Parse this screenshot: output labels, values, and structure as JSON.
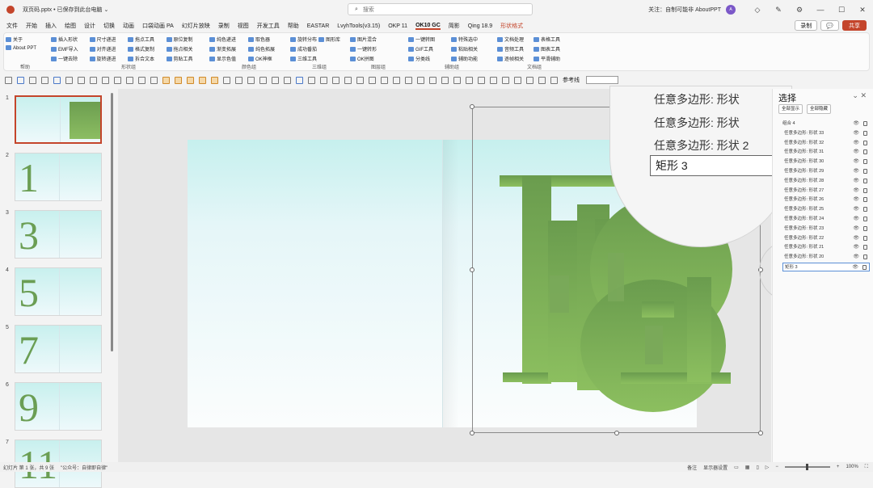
{
  "title_bar": {
    "file_name": "双页码.pptx • 已保存到此台电脑 ⌄",
    "search_placeholder": "搜索",
    "follow_text": "关注：自制可能非 AboutPPT",
    "avatar_text": "A",
    "icons": [
      "diamond-icon",
      "pen-icon",
      "settings-icon",
      "minimize-icon",
      "maximize-icon",
      "close-icon"
    ]
  },
  "menu": {
    "items": [
      "文件",
      "开始",
      "插入",
      "绘图",
      "设计",
      "切换",
      "动画",
      "口袋动画 PA",
      "幻灯片放映",
      "录制",
      "视图",
      "开发工具",
      "帮助",
      "EASTAR",
      "LvyhTools(v3.15)",
      "OKP 11",
      "OK10 GC",
      "简影",
      "Qing 18.9",
      "形状格式"
    ],
    "active_index": 16,
    "accent_index": 19,
    "record_label": "录制",
    "share_label": "共享"
  },
  "ribbon": {
    "groups": [
      {
        "label": "帮助",
        "buttons": [
          "关于",
          "About PPT"
        ]
      },
      {
        "label": "形状组",
        "buttons": [
          "插入形状",
          "EMF导入",
          "一键去除",
          "尺寸递进",
          "对齐递进",
          "旋转递进",
          "拖点工具",
          "格式复制",
          "拆合文本",
          "原位复制",
          "拖点相关",
          "剪贴工具"
        ]
      },
      {
        "label": "颜色组",
        "buttons": [
          "纯色递进",
          "渐变拓展",
          "显示色值",
          "取色器",
          "纯色拓展",
          "OK神框"
        ]
      },
      {
        "label": "三维组",
        "buttons": [
          "旋转分布",
          "成功番茄",
          "三维工具",
          "图形库"
        ]
      },
      {
        "label": "图层组",
        "buttons": [
          "图片混合",
          "一键转形",
          "OK拼图"
        ]
      },
      {
        "label": "辅助组",
        "buttons": [
          "一键转图",
          "GIF工具",
          "分类线",
          "特殊选中",
          "粘贴相关",
          "辅助功能"
        ]
      },
      {
        "label": "文档组",
        "buttons": [
          "文档处理",
          "音频工具",
          "逐帧相关",
          "表格工具",
          "图表工具",
          "平滑辅助"
        ]
      }
    ]
  },
  "toolbar": {
    "reference_line_label": "参考线"
  },
  "thumbnails": [
    {
      "number": "1",
      "digit": "",
      "has_green": true,
      "selected": true
    },
    {
      "number": "2",
      "digit": "1",
      "has_green": false,
      "selected": false
    },
    {
      "number": "3",
      "digit": "3",
      "has_green": false,
      "selected": false
    },
    {
      "number": "4",
      "digit": "5",
      "has_green": false,
      "selected": false
    },
    {
      "number": "5",
      "digit": "7",
      "has_green": false,
      "selected": false
    },
    {
      "number": "6",
      "digit": "9",
      "has_green": false,
      "selected": false
    },
    {
      "number": "7",
      "digit": "11",
      "has_green": false,
      "selected": false
    }
  ],
  "magnifier": {
    "items": [
      "任意多边形: 形状",
      "任意多边形: 形状",
      "任意多边形: 形状 2"
    ],
    "input_value": "矩形 3"
  },
  "selection_pane": {
    "title": "选择",
    "show_all": "全部显示",
    "hide_all": "全部隐藏",
    "layers": [
      "组合 4",
      "任意多边形: 形状 33",
      "任意多边形: 形状 32",
      "任意多边形: 形状 31",
      "任意多边形: 形状 30",
      "任意多边形: 形状 29",
      "任意多边形: 形状 28",
      "任意多边形: 形状 27",
      "任意多边形: 形状 26",
      "任意多边形: 形状 25",
      "任意多边形: 形状 24",
      "任意多边形: 形状 23",
      "任意多边形: 形状 22",
      "任意多边形: 形状 21",
      "任意多边形: 形状 20",
      "矩形 3"
    ],
    "selected_index": 15
  },
  "status_bar": {
    "slide_info": "幻灯片 第 1 张，共 9 张",
    "watermark": "\"公众号：自律即自律\"",
    "notes_label": "备注",
    "display_label": "显示器设置",
    "zoom_value": "100%"
  },
  "colors": {
    "accent": "#c4452b",
    "shape_green_top": "#6a9c4e",
    "shape_green_bottom": "#8cbf5f",
    "slide_top": "#c6f0ee"
  }
}
